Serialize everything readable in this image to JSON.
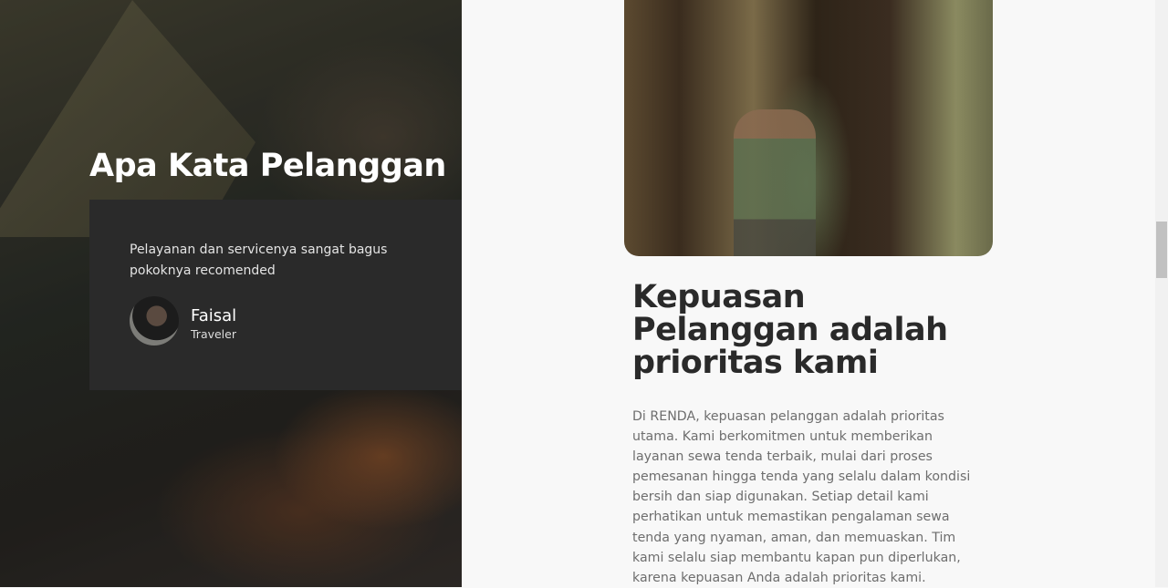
{
  "testimonials": {
    "title": "Apa Kata Pelanggan",
    "quote": "Pelayanan dan servicenya sangat bagus pokoknya recomended",
    "name": "Faisal",
    "role": "Traveler"
  },
  "about": {
    "heading": "Kepuasan Pelanggan adalah prioritas kami",
    "body": "Di RENDA, kepuasan pelanggan adalah prioritas utama. Kami berkomitmen untuk memberikan layanan sewa tenda terbaik, mulai dari proses pemesanan hingga tenda yang selalu dalam kondisi bersih dan siap digunakan. Setiap detail kami perhatikan untuk memastikan pengalaman sewa tenda yang nyaman, aman, dan memuaskan. Tim kami selalu siap membantu kapan pun diperlukan, karena kepuasan Anda adalah prioritas kami."
  }
}
